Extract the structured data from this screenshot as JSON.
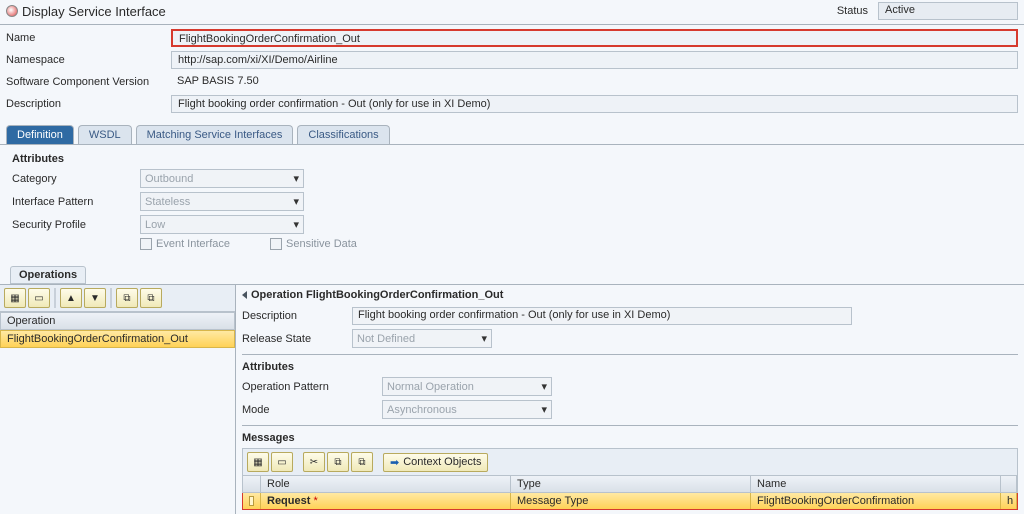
{
  "header": {
    "title": "Display Service Interface",
    "status_label": "Status",
    "status_value": "Active"
  },
  "fields": {
    "name_label": "Name",
    "name_value": "FlightBookingOrderConfirmation_Out",
    "namespace_label": "Namespace",
    "namespace_value": "http://sap.com/xi/XI/Demo/Airline",
    "scv_label": "Software Component Version",
    "scv_value": "SAP BASIS 7.50",
    "description_label": "Description",
    "description_value": "Flight booking order confirmation - Out (only for use in XI Demo)"
  },
  "tabs": {
    "definition": "Definition",
    "wsdl": "WSDL",
    "matching": "Matching Service Interfaces",
    "classifications": "Classifications"
  },
  "attributes": {
    "title": "Attributes",
    "category_label": "Category",
    "category_value": "Outbound",
    "pattern_label": "Interface Pattern",
    "pattern_value": "Stateless",
    "profile_label": "Security Profile",
    "profile_value": "Low",
    "event_interface": "Event Interface",
    "sensitive_data": "Sensitive Data"
  },
  "operations": {
    "panel_title": "Operations",
    "col_header": "Operation",
    "row_value": "FlightBookingOrderConfirmation_Out",
    "right_title": "Operation FlightBookingOrderConfirmation_Out",
    "desc_label": "Description",
    "desc_value": "Flight booking order confirmation - Out (only for use in XI Demo)",
    "release_label": "Release State",
    "release_value": "Not Defined",
    "attr_title": "Attributes",
    "op_pattern_label": "Operation Pattern",
    "op_pattern_value": "Normal Operation",
    "mode_label": "Mode",
    "mode_value": "Asynchronous",
    "messages_title": "Messages",
    "context_btn": "Context Objects",
    "col_role": "Role",
    "col_type": "Type",
    "col_name": "Name",
    "row_role": "Request",
    "row_star": "*",
    "row_type": "Message Type",
    "row_name": "FlightBookingOrderConfirmation",
    "row_last": "h"
  }
}
